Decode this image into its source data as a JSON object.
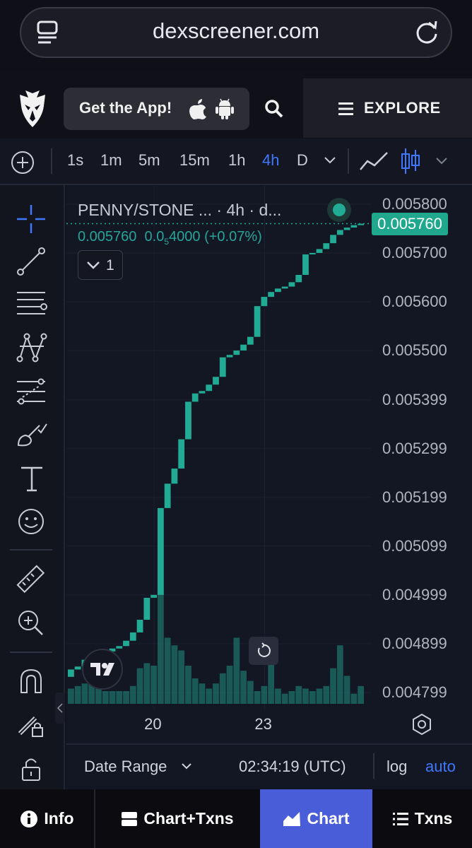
{
  "browser": {
    "url": "dexscreener.com"
  },
  "header": {
    "app_button": "Get the App!",
    "explore": "EXPLORE"
  },
  "toolbar": {
    "timeframes": [
      "1s",
      "1m",
      "5m",
      "15m",
      "1h",
      "4h",
      "D"
    ],
    "active_timeframe": "4h"
  },
  "left_tools": [
    "crosshair-icon",
    "trend-line-icon",
    "horizontal-lines-icon",
    "pattern-icon",
    "fib-icon",
    "brush-icon",
    "text-icon",
    "emoji-icon",
    "ruler-icon",
    "zoom-in-icon",
    "magnet-icon",
    "lock-drawing-icon",
    "lock-icon"
  ],
  "chart": {
    "legend_title": "PENNY/STONE ... · 4h · d...",
    "legend_price": "0.005760",
    "legend_change_prefix": "0.0",
    "legend_change_sub": "5",
    "legend_change_rest": "4000 (+0.07%)",
    "indicator_count": "1",
    "last_price": "0.005760",
    "colors": {
      "up": "#22ab94",
      "background": "#131623"
    }
  },
  "chart_data": {
    "type": "bar",
    "title": "PENNY/STONE ... · 4h · d...",
    "y_ticks": [
      "0.005800",
      "0.005700",
      "0.005600",
      "0.005500",
      "0.005399",
      "0.005299",
      "0.005199",
      "0.005099",
      "0.004999",
      "0.004899",
      "0.004799"
    ],
    "ylim": [
      0.004764,
      0.005839
    ],
    "x_ticks": [
      "20",
      "23"
    ],
    "close_series": [
      0.004846,
      0.004852,
      0.004866,
      0.004875,
      0.004879,
      0.004883,
      0.004889,
      0.004894,
      0.004905,
      0.004922,
      0.004948,
      0.004993,
      0.004999,
      0.005177,
      0.005227,
      0.005258,
      0.005318,
      0.005395,
      0.005412,
      0.005417,
      0.00543,
      0.005446,
      0.005486,
      0.005491,
      0.0055,
      0.005512,
      0.005528,
      0.005591,
      0.00561,
      0.00562,
      0.005627,
      0.005631,
      0.00564,
      0.005655,
      0.005697,
      0.0057,
      0.005708,
      0.00572,
      0.005737,
      0.005747,
      0.005752,
      0.005757,
      0.00576
    ],
    "volume_series": [
      0.12,
      0.14,
      0.16,
      0.28,
      0.18,
      0.1,
      0.1,
      0.1,
      0.1,
      0.14,
      0.28,
      0.32,
      0.3,
      0.9,
      0.52,
      0.46,
      0.42,
      0.3,
      0.2,
      0.16,
      0.12,
      0.16,
      0.24,
      0.3,
      0.52,
      0.26,
      0.18,
      0.1,
      0.14,
      0.48,
      0.12,
      0.08,
      0.1,
      0.14,
      0.12,
      0.1,
      0.12,
      0.14,
      0.28,
      0.46,
      0.22,
      0.08,
      0.14
    ],
    "last_price": 0.00576,
    "grid": true,
    "price_scale_position": "right"
  },
  "time_axis": {
    "ticks": [
      "20",
      "23"
    ]
  },
  "footer": {
    "date_range": "Date Range",
    "time": "02:34:19 (UTC)",
    "log": "log",
    "auto": "auto"
  },
  "nav": {
    "info": "Info",
    "chart_txns": "Chart+Txns",
    "chart": "Chart",
    "txns": "Txns"
  }
}
